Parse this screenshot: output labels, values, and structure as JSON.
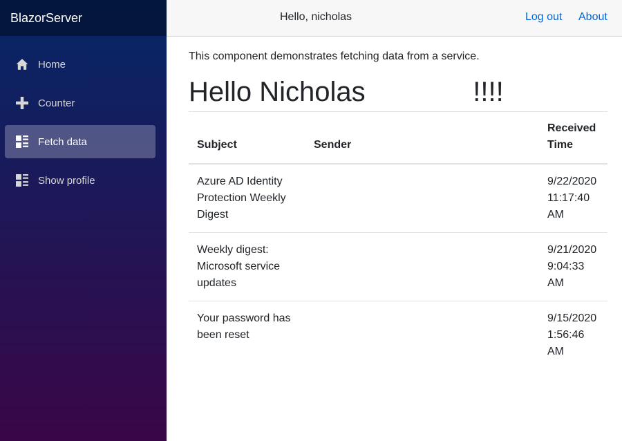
{
  "sidebar": {
    "brand": "BlazorServer",
    "items": [
      {
        "label": "Home",
        "icon": "home-icon"
      },
      {
        "label": "Counter",
        "icon": "plus-icon"
      },
      {
        "label": "Fetch data",
        "icon": "list-icon"
      },
      {
        "label": "Show profile",
        "icon": "list-icon"
      }
    ],
    "active_index": 2
  },
  "topbar": {
    "greeting": "Hello, nicholas",
    "logout_label": "Log out",
    "about_label": "About"
  },
  "main": {
    "intro": "This component demonstrates fetching data from a service.",
    "heading": "Hello Nicholas              !!!!",
    "table": {
      "headers": [
        "Subject",
        "Sender",
        "Received Time"
      ],
      "rows": [
        {
          "subject": "Azure AD Identity Protection Weekly Digest",
          "sender": "",
          "time": "9/22/2020 11:17:40 AM"
        },
        {
          "subject": "Weekly digest: Microsoft service updates",
          "sender": "",
          "time": "9/21/2020 9:04:33 AM"
        },
        {
          "subject": "Your password has been reset",
          "sender": "",
          "time": "9/15/2020 1:56:46 AM"
        }
      ]
    }
  },
  "colors": {
    "sidebar_top": "#052767",
    "sidebar_bottom": "#3a0647",
    "link": "#0366d6"
  }
}
